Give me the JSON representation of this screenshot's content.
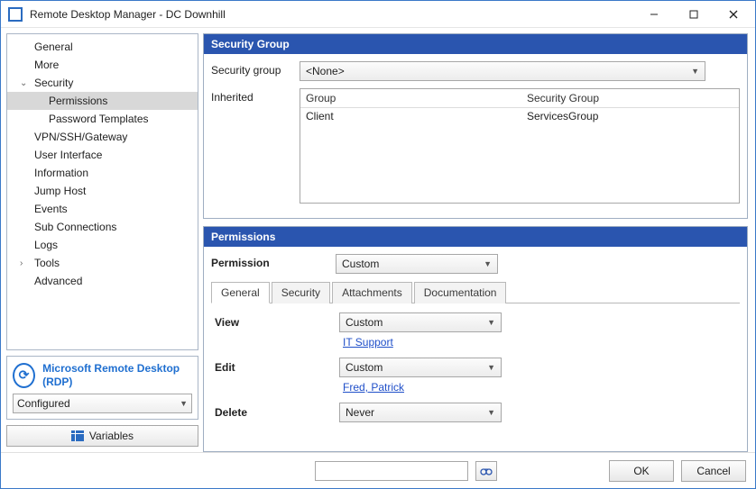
{
  "window": {
    "title": "Remote Desktop Manager - DC Downhill"
  },
  "nav": {
    "items": [
      {
        "label": "General",
        "depth": 0
      },
      {
        "label": "More",
        "depth": 0
      },
      {
        "label": "Security",
        "depth": 0,
        "exp": "open"
      },
      {
        "label": "Permissions",
        "depth": 1,
        "selected": true
      },
      {
        "label": "Password Templates",
        "depth": 1
      },
      {
        "label": "VPN/SSH/Gateway",
        "depth": 0
      },
      {
        "label": "User Interface",
        "depth": 0
      },
      {
        "label": "Information",
        "depth": 0
      },
      {
        "label": "Jump Host",
        "depth": 0
      },
      {
        "label": "Events",
        "depth": 0
      },
      {
        "label": "Sub Connections",
        "depth": 0
      },
      {
        "label": "Logs",
        "depth": 0
      },
      {
        "label": "Tools",
        "depth": 0,
        "exp": "closed"
      },
      {
        "label": "Advanced",
        "depth": 0
      }
    ]
  },
  "protocol": {
    "name": "Microsoft Remote Desktop (RDP)",
    "configured": "Configured"
  },
  "variablesBtn": "Variables",
  "securityGroup": {
    "header": "Security Group",
    "label": "Security group",
    "value": "<None>",
    "inheritedLabel": "Inherited",
    "cols": {
      "a": "Group",
      "b": "Security Group"
    },
    "rows": [
      {
        "a": "Client",
        "b": "ServicesGroup"
      }
    ]
  },
  "permissions": {
    "header": "Permissions",
    "label": "Permission",
    "value": "Custom",
    "tabs": [
      "General",
      "Security",
      "Attachments",
      "Documentation"
    ],
    "rows": {
      "view": {
        "label": "View",
        "value": "Custom",
        "link": "IT Support"
      },
      "edit": {
        "label": "Edit",
        "value": "Custom",
        "link": "Fred, Patrick"
      },
      "delete": {
        "label": "Delete",
        "value": "Never"
      }
    }
  },
  "footer": {
    "ok": "OK",
    "cancel": "Cancel"
  }
}
